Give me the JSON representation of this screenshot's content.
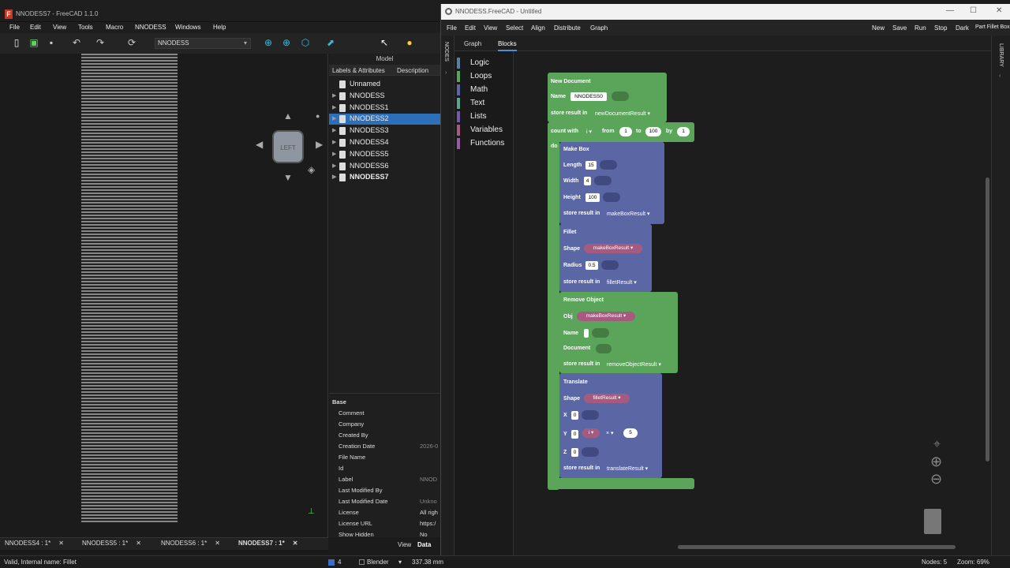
{
  "freecad": {
    "title": "NNODESS7 - FreeCAD 1.1.0",
    "menu": [
      "File",
      "Edit",
      "View",
      "Tools",
      "Macro",
      "NNODESS",
      "Windows",
      "Help"
    ],
    "workbench": "NNODESS",
    "tree_header": "Model",
    "columns": [
      "Labels & Attributes",
      "Description"
    ],
    "tree": [
      "Unnamed",
      "NNODESS",
      "NNODESS1",
      "NNODESS2",
      "NNODESS3",
      "NNODESS4",
      "NNODESS5",
      "NNODESS6",
      "NNODESS7"
    ],
    "selected": "NNODESS2",
    "props_group": "Base",
    "props": [
      {
        "k": "Comment",
        "v": ""
      },
      {
        "k": "Company",
        "v": ""
      },
      {
        "k": "Created By",
        "v": ""
      },
      {
        "k": "Creation Date",
        "v": "2026-0"
      },
      {
        "k": "File Name",
        "v": ""
      },
      {
        "k": "Id",
        "v": ""
      },
      {
        "k": "Label",
        "v": "NNOD"
      },
      {
        "k": "Last Modified By",
        "v": ""
      },
      {
        "k": "Last Modified Date",
        "v": "Unkno"
      },
      {
        "k": "License",
        "v": "All righ"
      },
      {
        "k": "License URL",
        "v": "https:/"
      },
      {
        "k": "Show Hidden",
        "v": "No"
      }
    ],
    "view_tab": "View",
    "data_tab": "Data",
    "nav_face": "LEFT",
    "doc_tabs": [
      "NNODESS4 : 1*",
      "NNODESS5 : 1*",
      "NNODESS6 : 1*",
      "NNODESS7 : 1*"
    ],
    "status_left": "Valid, Internal name: Fillet",
    "status_nav": "Blender",
    "status_count": "4",
    "status_dim": "337.38 mm"
  },
  "nnodess": {
    "title": "NNODESS.FreeCAD - Untitled",
    "menu": [
      "File",
      "Edit",
      "View",
      "Select",
      "Align",
      "Distribute",
      "Graph"
    ],
    "actions": [
      "New",
      "Save",
      "Run",
      "Stop",
      "Dark",
      "Part Fillet Box"
    ],
    "side_label": "NODES",
    "library_label": "LIBRARY",
    "tabs": [
      "Graph",
      "Blocks"
    ],
    "categories": [
      {
        "name": "Logic",
        "color": "#5b80a5"
      },
      {
        "name": "Loops",
        "color": "#5ba55b"
      },
      {
        "name": "Math",
        "color": "#5b67a5"
      },
      {
        "name": "Text",
        "color": "#5ba58c"
      },
      {
        "name": "Lists",
        "color": "#745ba5"
      },
      {
        "name": "Variables",
        "color": "#a55b80"
      },
      {
        "name": "Functions",
        "color": "#995ba5"
      }
    ],
    "blocks": {
      "new_doc": {
        "title": "New Document",
        "name_label": "Name",
        "name_value": "NNODESS0",
        "store": "store result in",
        "var": "newDocumentResult"
      },
      "loop": {
        "count": "count with",
        "var": "i",
        "from": "from",
        "from_v": "1",
        "to": "to",
        "to_v": "100",
        "by": "by",
        "by_v": "1",
        "do": "do"
      },
      "make_box": {
        "title": "Make Box",
        "length": "Length",
        "length_v": "15",
        "width": "Width",
        "width_v": "4",
        "height": "Height",
        "height_v": "100",
        "store": "store result in",
        "var": "makeBoxResult"
      },
      "fillet": {
        "title": "Fillet",
        "shape": "Shape",
        "shape_v": "makeBoxResult",
        "radius": "Radius",
        "radius_v": "0.5",
        "store": "store result in",
        "var": "filletResult"
      },
      "remove": {
        "title": "Remove Object",
        "obj": "Obj",
        "obj_v": "makeBoxResult",
        "name": "Name",
        "document": "Document",
        "store": "store result in",
        "var": "removeObjectResult"
      },
      "translate": {
        "title": "Translate",
        "shape": "Shape",
        "shape_v": "filletResult",
        "x": "X",
        "x_v": "0",
        "y": "Y",
        "y_v": "0",
        "y_var": "i",
        "y_op": "×",
        "y_num": "5",
        "z": "Z",
        "z_v": "0",
        "store": "store result in",
        "var": "translateResult"
      }
    },
    "status_nodes": "Nodes: 5",
    "status_zoom": "Zoom: 69%"
  }
}
